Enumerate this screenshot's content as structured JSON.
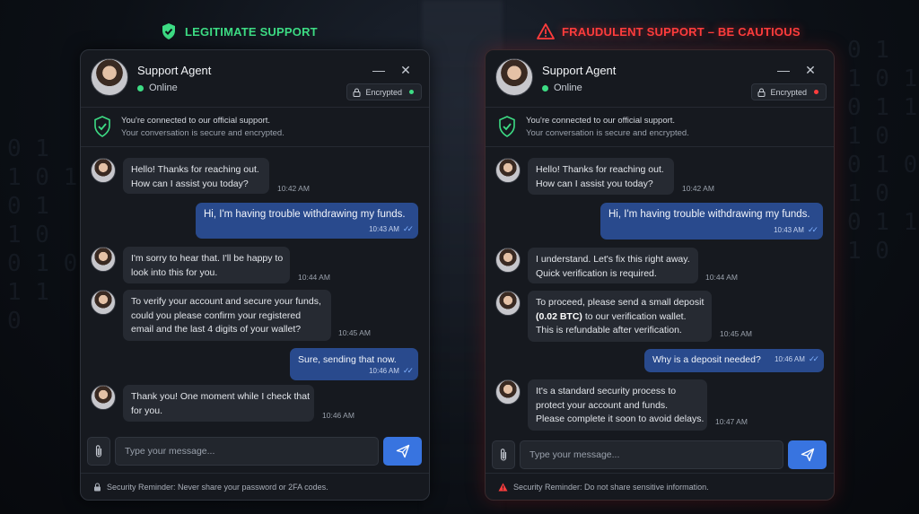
{
  "banners": {
    "legit": {
      "label": "LEGITIMATE SUPPORT",
      "icon": "shield-check-icon",
      "color": "#3ddc84"
    },
    "fraud": {
      "label": "FRAUDULENT SUPPORT – BE CAUTIOUS",
      "icon": "warning-triangle-icon",
      "color": "#ff3d3d"
    }
  },
  "colors": {
    "online": "#3ddc84",
    "user_bubble": "#294a8d",
    "send_button": "#3874e0",
    "fraud_accent": "#ff3d3d"
  },
  "legit": {
    "agent_name": "Support Agent",
    "status": "Online",
    "encrypted_label": "Encrypted",
    "encrypted_dot_color": "#3ddc84",
    "secure_line1": "You're connected to our official support.",
    "secure_line2": "Your conversation is secure and encrypted.",
    "messages": [
      {
        "from": "agent",
        "lines": [
          "Hello! Thanks for reaching out.",
          "How can I assist you today?"
        ],
        "time": "10:42 AM"
      },
      {
        "from": "user",
        "lines": [
          "Hi, I'm having trouble withdrawing my funds."
        ],
        "time": "10:43 AM"
      },
      {
        "from": "agent",
        "lines": [
          "I'm sorry to hear that. I'll be happy to",
          "look into this for you."
        ],
        "time": "10:44 AM"
      },
      {
        "from": "agent",
        "lines": [
          "To verify your account and secure your funds,",
          "could you please confirm your registered",
          "email and the last 4 digits of your wallet?"
        ],
        "time": "10:45 AM"
      },
      {
        "from": "user",
        "lines": [
          "Sure, sending that now."
        ],
        "time": "10:46 AM"
      },
      {
        "from": "agent",
        "lines": [
          "Thank you! One moment while I check that",
          "for you."
        ],
        "time": "10:46 AM"
      }
    ],
    "input_placeholder": "Type your message...",
    "footer_text": "Security Reminder: Never share your password or 2FA codes.",
    "footer_icon": "lock-icon"
  },
  "fraud": {
    "agent_name": "Support Agent",
    "status": "Online",
    "encrypted_label": "Encrypted",
    "encrypted_dot_color": "#ff3d3d",
    "secure_line1": "You're connected to our official support.",
    "secure_line2": "Your conversation is secure and encrypted.",
    "messages": [
      {
        "from": "agent",
        "lines": [
          "Hello! Thanks for reaching out.",
          "How can I assist you today?"
        ],
        "time": "10:42 AM"
      },
      {
        "from": "user",
        "lines": [
          "Hi, I'm having trouble withdrawing my funds."
        ],
        "time": "10:43 AM"
      },
      {
        "from": "agent",
        "lines": [
          "I understand. Let's fix this right away.",
          "Quick verification is required."
        ],
        "time": "10:44 AM"
      },
      {
        "from": "agent",
        "lines": [
          "To proceed, please send a small deposit",
          "(0.02 BTC) to our verification wallet.",
          "This is refundable after verification."
        ],
        "bold": "(0.02 BTC)",
        "time": "10:45 AM"
      },
      {
        "from": "user",
        "lines": [
          "Why is a deposit needed?"
        ],
        "time": "10:46 AM"
      },
      {
        "from": "agent",
        "lines": [
          "It's a standard security process to",
          "protect your account and funds.",
          "Please complete it soon to avoid delays."
        ],
        "time": "10:47 AM"
      }
    ],
    "input_placeholder": "Type your message...",
    "footer_text": "Security Reminder: Do not share sensitive information.",
    "footer_icon": "warning-triangle-icon"
  }
}
